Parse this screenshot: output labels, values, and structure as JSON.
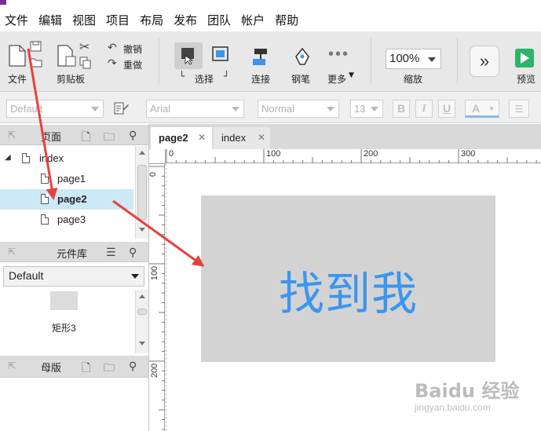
{
  "menu": [
    "文件",
    "编辑",
    "视图",
    "项目",
    "布局",
    "发布",
    "团队",
    "帐户",
    "帮助"
  ],
  "toolbar": {
    "file_label": "文件",
    "clipboard_label": "剪贴板",
    "undo_label": "撤销",
    "redo_label": "重做",
    "select_label": "选择",
    "connect_label": "连接",
    "pen_label": "钢笔",
    "more_label": "更多",
    "zoom_value": "100%",
    "zoom_label": "缩放",
    "preview_label": "预览"
  },
  "formatbar": {
    "style_value": "Default",
    "font_value": "Arial",
    "weight_value": "Normal",
    "size_value": "13",
    "bold": "B",
    "italic": "I",
    "underline": "U",
    "font_color": "A"
  },
  "pages_panel": {
    "title": "页面",
    "items": [
      {
        "label": "index",
        "level": 0,
        "selected": false
      },
      {
        "label": "page1",
        "level": 1,
        "selected": false
      },
      {
        "label": "page2",
        "level": 1,
        "selected": true
      },
      {
        "label": "page3",
        "level": 1,
        "selected": false
      }
    ]
  },
  "library_panel": {
    "title": "元件库",
    "dropdown_value": "Default",
    "widget_label": "矩形3"
  },
  "masters_panel": {
    "title": "母版"
  },
  "tabs": [
    {
      "label": "page2",
      "active": true
    },
    {
      "label": "index",
      "active": false
    }
  ],
  "ruler": {
    "h_ticks": [
      "0",
      "100",
      "200",
      "300"
    ],
    "v_ticks": [
      "0",
      "100",
      "200"
    ]
  },
  "canvas": {
    "rect_text": "找到我",
    "rect_fill": "#d3d3d3",
    "text_color": "#3b96f0"
  },
  "watermark": {
    "brand": "Baidu 经验",
    "url": "jingyan.baidu.com"
  },
  "colors": {
    "accent": "#3b96f0",
    "annotation_arrow": "#e8413d",
    "selected_row": "#cde8f7",
    "preview_green": "#2fb36b"
  }
}
